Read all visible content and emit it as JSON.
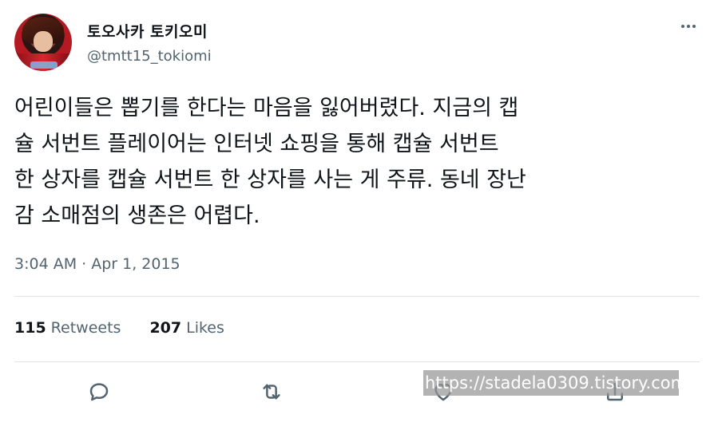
{
  "user": {
    "display_name": "토오사카 토키오미",
    "handle": "@tmtt15_tokiomi"
  },
  "tweet": {
    "text": "어린이들은 뽑기를 한다는 마음을 잃어버렸다. 지금의 캡\n슐 서번트 플레이어는 인터넷 쇼핑을 통해 캡슐 서번트\n한 상자를 캡슐 서번트 한 상자를 사는 게 주류. 동네 장난\n감 소매점의 생존은 어렵다.",
    "timestamp": "3:04 AM · Apr 1, 2015"
  },
  "stats": {
    "retweets_count": "115",
    "retweets_label": "Retweets",
    "likes_count": "207",
    "likes_label": "Likes"
  },
  "actions": {
    "icons": [
      "reply-icon",
      "retweet-icon",
      "like-icon",
      "share-icon"
    ]
  },
  "watermark": {
    "text": "https://stadela0309.tistory.com"
  },
  "colors": {
    "text_primary": "#0f1419",
    "text_secondary": "#536471",
    "divider": "#dfe3e7"
  }
}
